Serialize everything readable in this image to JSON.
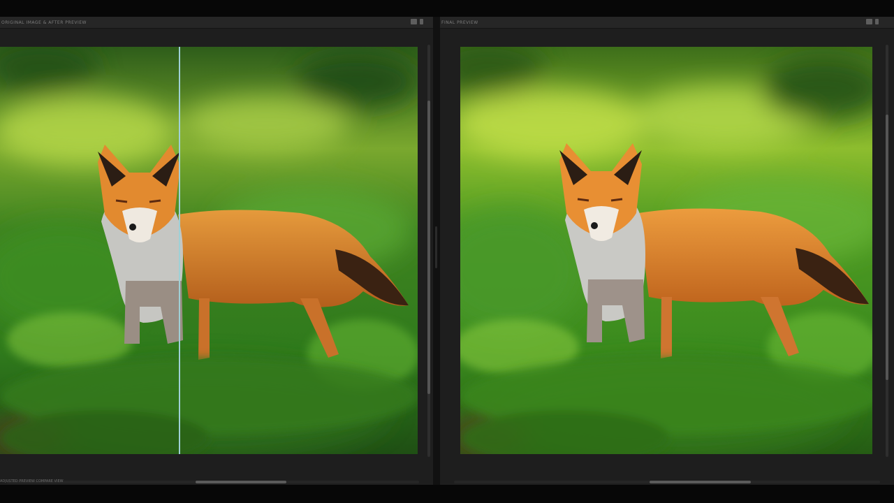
{
  "window": {
    "left_panel_title": "ORIGINAL IMAGE & AFTER PREVIEW",
    "right_panel_title": "FINAL PREVIEW",
    "left_status": "ADJUSTED PREVIEW COMPARE VIEW"
  },
  "preview": {
    "compare_split_fraction": 0.43
  },
  "colors": {
    "divider": "#9fd0d6",
    "panel": "#1e1e1e",
    "foliage_dark": "#1d4a12",
    "foliage_light": "#a6d040",
    "fox_fur": "#d27a2a"
  }
}
